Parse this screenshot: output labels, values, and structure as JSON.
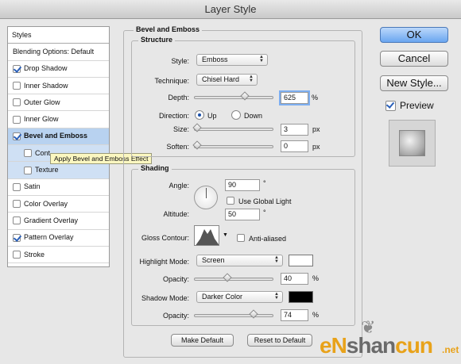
{
  "window": {
    "title": "Layer Style"
  },
  "sidebar": {
    "header": "Styles",
    "items": [
      {
        "label": "Blending Options: Default",
        "checkbox": false,
        "checked": false,
        "indent": false,
        "selected": false
      },
      {
        "label": "Drop Shadow",
        "checkbox": true,
        "checked": true,
        "indent": false,
        "selected": false
      },
      {
        "label": "Inner Shadow",
        "checkbox": true,
        "checked": false,
        "indent": false,
        "selected": false
      },
      {
        "label": "Outer Glow",
        "checkbox": true,
        "checked": false,
        "indent": false,
        "selected": false
      },
      {
        "label": "Inner Glow",
        "checkbox": true,
        "checked": false,
        "indent": false,
        "selected": false
      },
      {
        "label": "Bevel and Emboss",
        "checkbox": true,
        "checked": true,
        "indent": false,
        "selected": true
      },
      {
        "label": "Cont",
        "checkbox": true,
        "checked": false,
        "indent": true,
        "selected": false
      },
      {
        "label": "Texture",
        "checkbox": true,
        "checked": false,
        "indent": true,
        "selected": false
      },
      {
        "label": "Satin",
        "checkbox": true,
        "checked": false,
        "indent": false,
        "selected": false
      },
      {
        "label": "Color Overlay",
        "checkbox": true,
        "checked": false,
        "indent": false,
        "selected": false
      },
      {
        "label": "Gradient Overlay",
        "checkbox": true,
        "checked": false,
        "indent": false,
        "selected": false
      },
      {
        "label": "Pattern Overlay",
        "checkbox": true,
        "checked": true,
        "indent": false,
        "selected": false
      },
      {
        "label": "Stroke",
        "checkbox": true,
        "checked": false,
        "indent": false,
        "selected": false
      }
    ],
    "tooltip": "Apply Bevel and Emboss Effect"
  },
  "bevel": {
    "title": "Bevel and Emboss",
    "structure_title": "Structure",
    "style_label": "Style:",
    "style_value": "Emboss",
    "technique_label": "Technique:",
    "technique_value": "Chisel Hard",
    "depth_label": "Depth:",
    "depth_value": "625",
    "depth_unit": "%",
    "direction_label": "Direction:",
    "direction_up": "Up",
    "direction_down": "Down",
    "size_label": "Size:",
    "size_value": "3",
    "size_unit": "px",
    "soften_label": "Soften:",
    "soften_value": "0",
    "soften_unit": "px"
  },
  "shading": {
    "title": "Shading",
    "angle_label": "Angle:",
    "angle_value": "90",
    "angle_unit": "°",
    "global_light_label": "Use Global Light",
    "altitude_label": "Altitude:",
    "altitude_value": "50",
    "altitude_unit": "°",
    "gloss_label": "Gloss Contour:",
    "anti_aliased_label": "Anti-aliased",
    "highlight_mode_label": "Highlight Mode:",
    "highlight_mode_value": "Screen",
    "highlight_color": "#ffffff",
    "highlight_opacity_label": "Opacity:",
    "highlight_opacity_value": "40",
    "highlight_opacity_unit": "%",
    "shadow_mode_label": "Shadow Mode:",
    "shadow_mode_value": "Darker Color",
    "shadow_color": "#000000",
    "shadow_opacity_label": "Opacity:",
    "shadow_opacity_value": "74",
    "shadow_opacity_unit": "%"
  },
  "sliders": {
    "depth": 0.62,
    "size": 0.0,
    "soften": 0.0,
    "highlight_opacity": 0.4,
    "shadow_opacity": 0.74
  },
  "buttons": {
    "ok": "OK",
    "cancel": "Cancel",
    "new_style": "New Style...",
    "preview_label": "Preview",
    "make_default": "Make Default",
    "reset_default": "Reset to Default"
  },
  "watermark": {
    "prefix": "eN",
    "brand_a": "shan",
    "brand_b": "cun",
    "suffix": ".net"
  }
}
